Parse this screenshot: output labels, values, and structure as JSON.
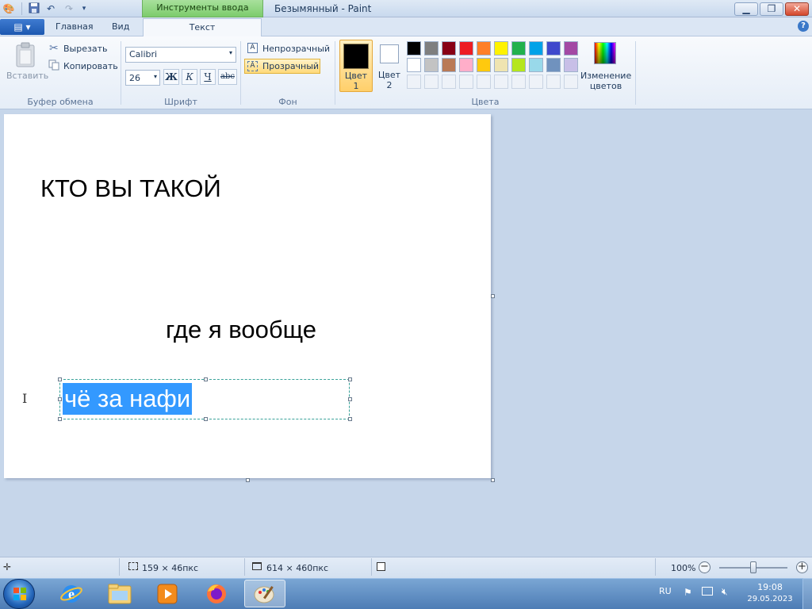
{
  "titlebar": {
    "contextual_tab": "Инструменты ввода текста",
    "title": "Безымянный - Paint",
    "minimize": "▁",
    "maximize": "❐",
    "close": "✕"
  },
  "tabs": {
    "home": "Главная",
    "view": "Вид",
    "text": "Текст"
  },
  "ribbon": {
    "clipboard": {
      "label": "Буфер обмена",
      "paste": "Вставить",
      "cut": "Вырезать",
      "copy": "Копировать"
    },
    "font": {
      "label": "Шрифт",
      "family": "Calibri",
      "size": "26",
      "bold": "Ж",
      "italic": "К",
      "underline": "Ч",
      "strike": "abc"
    },
    "background": {
      "label": "Фон",
      "opaque": "Непрозрачный",
      "transparent": "Прозрачный"
    },
    "colors": {
      "label": "Цвета",
      "color1_line1": "Цвет",
      "color1_line2": "1",
      "color2_line1": "Цвет",
      "color2_line2": "2",
      "edit_line1": "Изменение",
      "edit_line2": "цветов",
      "color1_value": "#000000",
      "color2_value": "#ffffff",
      "palette": [
        [
          "#000000",
          "#7f7f7f",
          "#880015",
          "#ed1c24",
          "#ff7f27",
          "#fff200",
          "#22b14c",
          "#00a2e8",
          "#3f48cc",
          "#a349a4"
        ],
        [
          "#ffffff",
          "#c3c3c3",
          "#b97a57",
          "#ffaec9",
          "#ffc90e",
          "#efe4b0",
          "#b5e61d",
          "#99d9ea",
          "#7092be",
          "#c8bfe7"
        ],
        [
          "",
          "",
          "",
          "",
          "",
          "",
          "",
          "",
          "",
          ""
        ]
      ]
    }
  },
  "canvas": {
    "text1": "КТО ВЫ ТАКОЙ",
    "text2": "где я вообще",
    "editing_text": "чё за нафи"
  },
  "statusbar": {
    "selection_size": "159 × 46пкс",
    "image_size": "614 × 460пкс",
    "zoom": "100%",
    "zoom_level": 1.0
  },
  "taskbar": {
    "language": "RU",
    "time": "19:08",
    "date": "29.05.2023"
  }
}
